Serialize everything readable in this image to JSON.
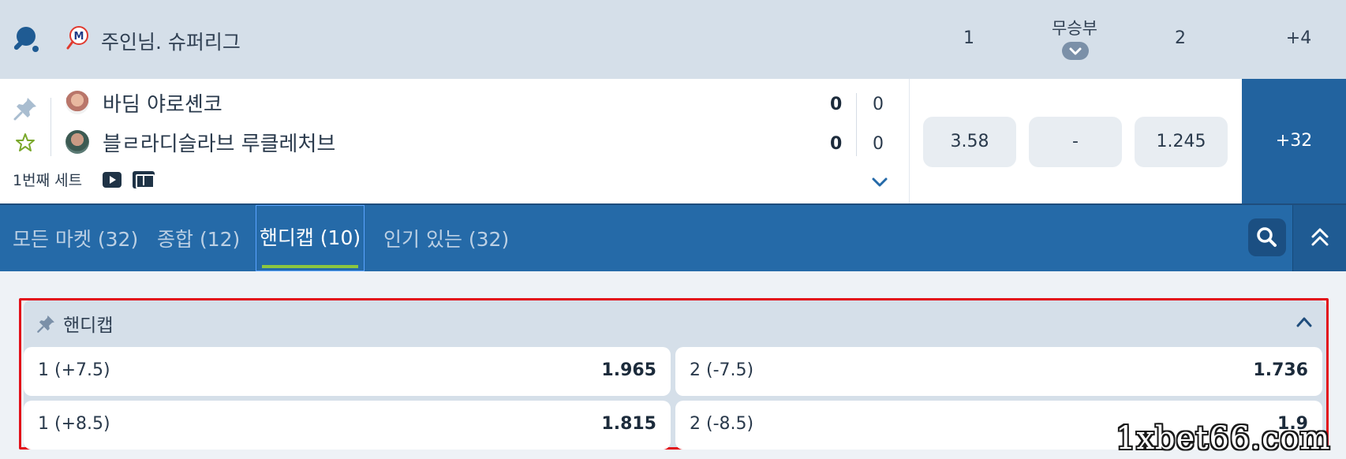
{
  "league": {
    "name": "주인님. 슈퍼리그",
    "logo_letter": "M",
    "columns": {
      "home": "1",
      "draw": "무승부",
      "away": "2",
      "more": "+4"
    }
  },
  "event": {
    "team1": {
      "name": "바딤 야로셴코",
      "score_bold": "0",
      "score": "0"
    },
    "team2": {
      "name": "블ㄹ라디슬라브 루클레처브",
      "score_bold": "0",
      "score": "0"
    },
    "period": "1번째 세트",
    "odds": {
      "home": "3.58",
      "draw": "-",
      "away": "1.245"
    },
    "more_markets": "+32"
  },
  "tabs": [
    {
      "label": "모든 마켓 (32)",
      "active": false
    },
    {
      "label": "종합 (12)",
      "active": false
    },
    {
      "label": "핸디캡 (10)",
      "active": true
    },
    {
      "label": "인기 있는 (32)",
      "active": false
    }
  ],
  "market": {
    "title": "핸디캡",
    "outcomes": [
      {
        "label": "1 (+7.5)",
        "odd": "1.965"
      },
      {
        "label": "2 (-7.5)",
        "odd": "1.736"
      },
      {
        "label": "1 (+8.5)",
        "odd": "1.815"
      },
      {
        "label": "2 (-8.5)",
        "odd": "1.9"
      }
    ]
  },
  "watermark": "1xbet66.com",
  "colors": {
    "header_bg": "#d5dfe9",
    "tabs_bg": "#256aa8",
    "more_btn_bg": "#22639f",
    "active_underline": "#8cc63f",
    "highlight_frame": "#e21019"
  }
}
